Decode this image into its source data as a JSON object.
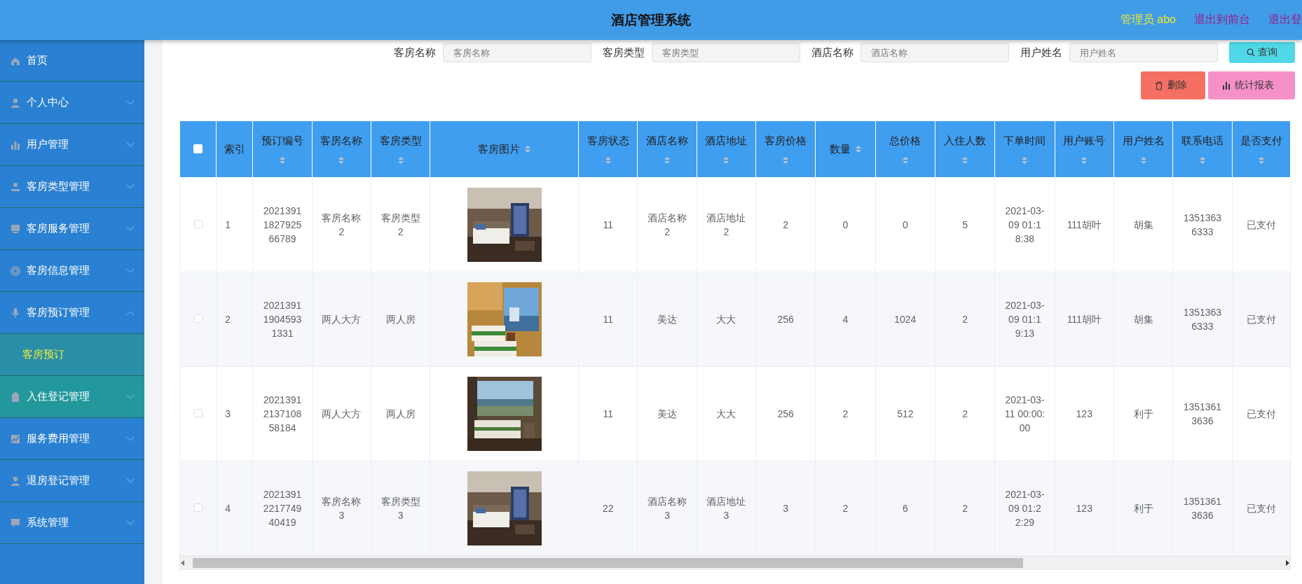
{
  "header": {
    "title": "酒店管理系统",
    "user": "管理员 abo",
    "links": [
      "退出到前台",
      "退出登"
    ]
  },
  "sidebar": {
    "items": [
      {
        "label": "首页",
        "kind": "link",
        "hovered": false
      },
      {
        "label": "个人中心",
        "kind": "menu",
        "expanded": false,
        "hovered": false
      },
      {
        "label": "用户管理",
        "kind": "menu",
        "expanded": false,
        "hovered": false
      },
      {
        "label": "客房类型管理",
        "kind": "menu",
        "expanded": false,
        "hovered": false
      },
      {
        "label": "客房服务管理",
        "kind": "menu",
        "expanded": false,
        "hovered": false
      },
      {
        "label": "客房信息管理",
        "kind": "menu",
        "expanded": false,
        "hovered": false
      },
      {
        "label": "客房预订管理",
        "kind": "menu",
        "expanded": true,
        "hovered": false,
        "children": [
          {
            "label": "客房预订",
            "selected": true
          }
        ]
      },
      {
        "label": "入住登记管理",
        "kind": "menu",
        "expanded": false,
        "hovered": true
      },
      {
        "label": "服务费用管理",
        "kind": "menu",
        "expanded": false,
        "hovered": false
      },
      {
        "label": "退房登记管理",
        "kind": "menu",
        "expanded": false,
        "hovered": false
      },
      {
        "label": "系统管理",
        "kind": "menu",
        "expanded": false,
        "hovered": false
      }
    ]
  },
  "search": {
    "fields": [
      {
        "label": "客房名称",
        "placeholder": "客房名称"
      },
      {
        "label": "客房类型",
        "placeholder": "客房类型"
      },
      {
        "label": "酒店名称",
        "placeholder": "酒店名称"
      },
      {
        "label": "用户姓名",
        "placeholder": "用户姓名"
      }
    ],
    "button": "查询"
  },
  "actions": [
    {
      "label": "删除",
      "kind": "delete"
    },
    {
      "label": "统计报表",
      "kind": "report"
    }
  ],
  "table": {
    "columns": [
      {
        "kind": "check",
        "checked": false
      },
      {
        "label": "索引",
        "kind": "plain"
      },
      {
        "label": "预订编号",
        "kind": "stacked"
      },
      {
        "label": "客房名称",
        "kind": "stacked"
      },
      {
        "label": "客房类型",
        "kind": "stacked"
      },
      {
        "label": "客房图片",
        "kind": "inline"
      },
      {
        "label": "客房状态",
        "kind": "stacked"
      },
      {
        "label": "酒店名称",
        "kind": "stacked"
      },
      {
        "label": "酒店地址",
        "kind": "stacked"
      },
      {
        "label": "客房价格",
        "kind": "stacked"
      },
      {
        "label": "数量",
        "kind": "inline"
      },
      {
        "label": "总价格",
        "kind": "stacked"
      },
      {
        "label": "入住人数",
        "kind": "stacked"
      },
      {
        "label": "下单时间",
        "kind": "stacked"
      },
      {
        "label": "用户账号",
        "kind": "stacked"
      },
      {
        "label": "用户姓名",
        "kind": "stacked"
      },
      {
        "label": "联系电话",
        "kind": "stacked"
      },
      {
        "label": "是否支付",
        "kind": "stacked"
      }
    ],
    "rows": [
      {
        "cells": [
          {
            "kind": "checkbox",
            "selected": false
          },
          "1",
          "2021391182792566789",
          "客房名称2",
          "客房类型2",
          {
            "kind": "picture"
          },
          "11",
          "酒店名称2",
          "酒店地址2",
          "2",
          "0",
          "0",
          "5",
          "2021-03-09 01:18:38",
          "111胡叶",
          "胡集",
          "13513636333",
          "已支付"
        ]
      },
      {
        "cells": [
          {
            "kind": "checkbox",
            "selected": false
          },
          "2",
          "202139119045931331",
          "两人大方",
          "两人房",
          {
            "kind": "picture"
          },
          "11",
          "美达",
          "大大",
          "256",
          "4",
          "1024",
          "2",
          "2021-03-09 01:19:13",
          "111胡叶",
          "胡集",
          "13513636333",
          "已支付"
        ]
      },
      {
        "cells": [
          {
            "kind": "checkbox",
            "selected": false
          },
          "3",
          "2021391213710858184",
          "两人大方",
          "两人房",
          {
            "kind": "picture"
          },
          "11",
          "美达",
          "大大",
          "256",
          "2",
          "512",
          "2",
          "2021-03-11 00:00:00",
          "123",
          "利于",
          "13513613636",
          "已支付"
        ]
      },
      {
        "cells": [
          {
            "kind": "checkbox",
            "selected": false
          },
          "4",
          "2021391221774940419",
          "客房名称3",
          "客房类型3",
          {
            "kind": "picture"
          },
          "22",
          "酒店名称3",
          "酒店地址3",
          "3",
          "2",
          "6",
          "2",
          "2021-03-09 01:22:29",
          "123",
          "利于",
          "13513613636",
          "已支付"
        ]
      }
    ]
  }
}
